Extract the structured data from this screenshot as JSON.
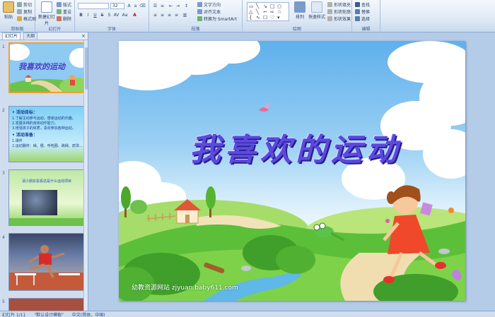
{
  "ribbon": {
    "clipboard": {
      "paste": "粘贴",
      "cut": "剪切",
      "copy": "复制",
      "format_painter": "格式刷",
      "label": "剪贴板"
    },
    "slides": {
      "new_slide": "新建幻灯片",
      "layout": "版式",
      "reset": "重设",
      "delete": "删除",
      "label": "幻灯片"
    },
    "font": {
      "font_name": "",
      "font_size": "32",
      "label": "字体"
    },
    "paragraph": {
      "text_direction": "文字方向",
      "align_text": "对齐文本",
      "convert_smartart": "转换为 SmartArt",
      "label": "段落"
    },
    "drawing": {
      "arrange": "排列",
      "quick_styles": "快速样式",
      "shape_fill": "形状填充",
      "shape_outline": "形状轮廓",
      "shape_effects": "形状效果",
      "label": "绘图"
    },
    "editing": {
      "find": "查找",
      "replace": "替换",
      "select": "选择",
      "label": "编辑"
    }
  },
  "left_pane": {
    "tabs": [
      "幻灯片",
      "大纲"
    ],
    "slides": [
      {
        "num": "1",
        "title": "我喜欢的运动"
      },
      {
        "num": "2",
        "lines": [
          "• 活动目标：",
          "1.了解主动参与运动，感受运动的乐趣。",
          "2.发展多种的身体动作能力。",
          "3.增强孩子的体质，喜欢参加各种运动。",
          "• 活动准备：",
          "1.课件",
          "2.运动器材：绳、毽、呼啦圈、跳绳、皮球..."
        ]
      },
      {
        "num": "3",
        "caption": "请小朋友看看这是什么运动项目"
      },
      {
        "num": "4"
      },
      {
        "num": "5"
      }
    ]
  },
  "slide": {
    "title": "我喜欢的运动",
    "watermark": "幼教资源网站 zjyuan.baby611.com"
  },
  "statusbar": {
    "slide_info": "幻灯片 1/11",
    "theme": "\"默认设计模板\"",
    "language": "中文(简体，中国)"
  }
}
